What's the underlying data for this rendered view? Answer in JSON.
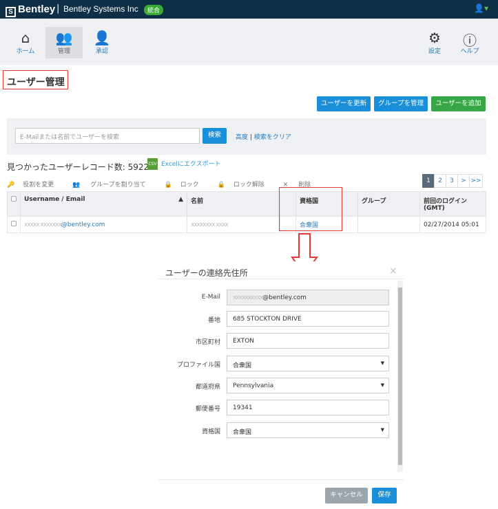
{
  "topbar": {
    "brand": "Bentley",
    "org": "Bentley Systems Inc",
    "badge": "統合"
  },
  "nav": {
    "items": [
      {
        "label": "ホーム"
      },
      {
        "label": "管理"
      },
      {
        "label": "承認"
      }
    ],
    "right": [
      {
        "label": "設定"
      },
      {
        "label": "ヘルプ"
      }
    ]
  },
  "page": {
    "title": "ユーザー管理"
  },
  "buttons": {
    "refresh": "ユーザーを更新",
    "groups": "グループを管理",
    "add": "ユーザーを追加"
  },
  "search": {
    "placeholder": "E-Mailまたは名前でユーザーを検索",
    "button": "検索",
    "advanced": "高度",
    "separator": "|",
    "clear": "検索をクリア"
  },
  "results": {
    "label": "見つかったユーザーレコード数:",
    "count": "5922",
    "export": "Excelにエクスポート",
    "csv": "CSV"
  },
  "actions": {
    "role": "役割を変更",
    "assign": "グループを割り当て",
    "lock": "ロック",
    "unlock": "ロック解除",
    "delete": "削除"
  },
  "pager": [
    "1",
    "2",
    "3",
    ">",
    ">>"
  ],
  "table": {
    "headers": {
      "user": "Username / Email",
      "name": "名前",
      "country": "資格国",
      "group": "グループ",
      "login": "前回のログイン (GMT)"
    },
    "rows": [
      {
        "user_mask": "xxxxx xxxxxxx",
        "user_domain": "@bentley.com",
        "name_mask": "xxxxxxxx xxxx",
        "country": "合衆国",
        "group": "",
        "login": "02/27/2014 05:01"
      }
    ]
  },
  "modal": {
    "title": "ユーザーの連絡先住所",
    "close": "×",
    "fields": [
      {
        "label": "E-Mail",
        "mask": "xxxxxxxxxx",
        "value": "@bentley.com"
      },
      {
        "label": "番地",
        "value": "685 STOCKTON DRIVE"
      },
      {
        "label": "市区町村",
        "value": "EXTON"
      },
      {
        "label": "プロファイル国",
        "value": "合衆国"
      },
      {
        "label": "都道府県",
        "value": "Pennsylvania"
      },
      {
        "label": "郵便番号",
        "value": "19341"
      },
      {
        "label": "資格国",
        "value": "合衆国"
      }
    ],
    "cancel": "キャンセル",
    "save": "保存"
  },
  "colors": {
    "topbar": "#0e2f45",
    "primary": "#1a8ed8",
    "success": "#36a646",
    "annotation": "#e53935"
  }
}
